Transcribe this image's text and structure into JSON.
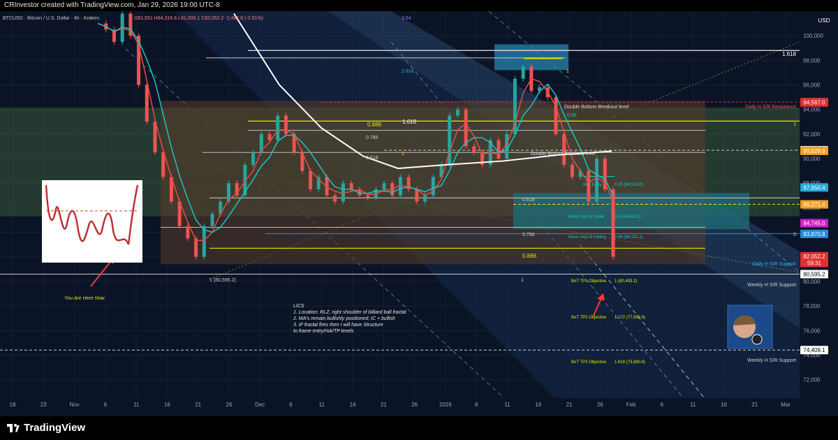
{
  "header": {
    "credit": "CRInvestor created with TradingView.com, Jan 29, 2026 19:00 UTC-8",
    "symbol_line": "BTCUSD · Bitcoin / U.S. Dollar · 4h · Kraken",
    "ohlc": "O81,551  H84,316.6  L81,000.1  C82,052.2  -2,462.9 (-2.91%)",
    "currency": "USD"
  },
  "footer": {
    "brand": "TradingView"
  },
  "colors": {
    "background": "#0b1426",
    "candle_up": "#26a69a",
    "candle_down": "#ef5350",
    "fib_yellow": "#e6e600",
    "ma_white": "#ffffff",
    "ma_teal": "#22c1c3",
    "ma_red": "#e64a4a",
    "box_green": "#3a5a3a",
    "box_orange": "#5a3d2a",
    "box_teal": "#1e6f7a"
  },
  "chart_data": {
    "type": "line",
    "title": "",
    "xlabel": "",
    "ylabel": "",
    "ylim": [
      70500,
      102000
    ],
    "x_ticks": [
      "18",
      "23",
      "Nov",
      "6",
      "11",
      "16",
      "21",
      "26",
      "Dec",
      "6",
      "11",
      "16",
      "21",
      "26",
      "2026",
      "6",
      "11",
      "16",
      "21",
      "26",
      "Feb",
      "6",
      "11",
      "16",
      "21",
      "Mar"
    ],
    "y_ticks": [
      "72,000",
      "74,000",
      "76,000",
      "78,000",
      "80,000",
      "82,000",
      "84,000",
      "86,000",
      "88,000",
      "90,000",
      "92,000",
      "94,000",
      "96,000",
      "98,000",
      "100,000"
    ],
    "grid": true,
    "series": [
      {
        "name": "",
        "values": [
          101000,
          100500,
          99500,
          101800,
          100000,
          96000,
          93000,
          90500,
          88500,
          86500,
          84500,
          83500,
          82000,
          84500,
          85500,
          86500,
          88000,
          87000,
          89500,
          90500,
          92000,
          91500,
          93500,
          92000,
          90500,
          89000,
          87500,
          88500,
          87000,
          86500,
          88000,
          87500,
          87000,
          86800,
          87500,
          88000,
          87000,
          88500,
          87500,
          86500,
          87000,
          88500,
          89500,
          93500,
          94000,
          91000,
          90500,
          89500,
          91500,
          90000,
          92000,
          96500,
          97500,
          95500,
          95800,
          95000,
          92000,
          89500,
          88500,
          89000,
          86500,
          90000,
          87500,
          82000
        ]
      }
    ],
    "price_labels": [
      {
        "text": "94,583.7",
        "value": 94583.7,
        "color": "#f08c3c"
      },
      {
        "text": "94,567.0",
        "value": 94567.0,
        "color": "#e03030"
      },
      {
        "text": "90,678.2",
        "value": 90678.2,
        "color": "#ffffff"
      },
      {
        "text": "90,629.9",
        "value": 90629.9,
        "color": "#f0a020"
      },
      {
        "text": "87,650.4",
        "value": 87650.4,
        "color": "#2aa8d8"
      },
      {
        "text": "86,281.8",
        "value": 86281.8,
        "color": "#f08c3c"
      },
      {
        "text": "86,271.4",
        "value": 86271.4,
        "color": "#f0a020"
      },
      {
        "text": "84,745.0",
        "value": 84745.0,
        "color": "#d020c8"
      },
      {
        "text": "83,870.8",
        "value": 83870.8,
        "color": "#2a8ad8"
      },
      {
        "text": "82,052.2",
        "value": 82052.2,
        "color": "#e03030"
      },
      {
        "text": "59:31",
        "value": 81500,
        "color": "#e03030"
      },
      {
        "text": "80,595.2",
        "value": 80595.2,
        "color": "#ffffff"
      },
      {
        "text": "74,409.1",
        "value": 74409.1,
        "color": "#ffffff"
      }
    ],
    "annotations": {
      "fib_top": "1.618",
      "fib_1": "1",
      "fib_0": "0",
      "fib_3_64": "3.64",
      "fib_2_618": "2.618",
      "fib_1_top": "1",
      "double_bottom_1": "Double Bottom Breakout level",
      "double_bottom_2": "Double Bottom Breakout level",
      "fib_0_66": "0.66",
      "daily_resistance": "Daily H S/R Resistance",
      "fib_1_618_mid": "1.618",
      "fib_0_886_top": "0.886",
      "fib_1_right": "1",
      "fib_0_786_top": "0.786",
      "fib_1_left": "1",
      "fib_0_618_top": "0.618",
      "bot_entry": "BoT Entry",
      "fib_025": "0.25 (88,518.0)",
      "fib_0_618_low": "0.618",
      "move_stop_break": "Move stop to break",
      "fib_0_5": "0.5 (85,643.1)",
      "fib_0_786_low": "0.786",
      "move_stop_trailing": "Move stop to trailing",
      "fib_0_66_low": "0.66 (84,131.1)",
      "fib_0_right": "0",
      "daily_support": "Daily H S/R Support",
      "fib_0_886_low": "0.886",
      "low_left": "1 (80,595.2)",
      "low_1": "1",
      "tp1": "BoT TP1 Objective",
      "tp1_val": "1 (80,493.2)",
      "weekly_support_1": "Weekly H S/R Support",
      "tp2": "BoT TP2 Objective",
      "tp2_val": "1.272 (77,582.9)",
      "tp3": "BoT TP3 Objective",
      "tp3_val": "1.618 (73,880.8)",
      "weekly_support_2": "Weekly H S/R Support",
      "you_are_here": "You Are Here Now"
    },
    "notes": [
      "LICS",
      "1. Location: RLZ, right shoulder of billiard ball fractal",
      "2. MA's remain bullishly positioned; IC + bullish",
      "3. IF fractal fires then I will have Structure",
      "to frame entry/risk/TP levels"
    ]
  }
}
